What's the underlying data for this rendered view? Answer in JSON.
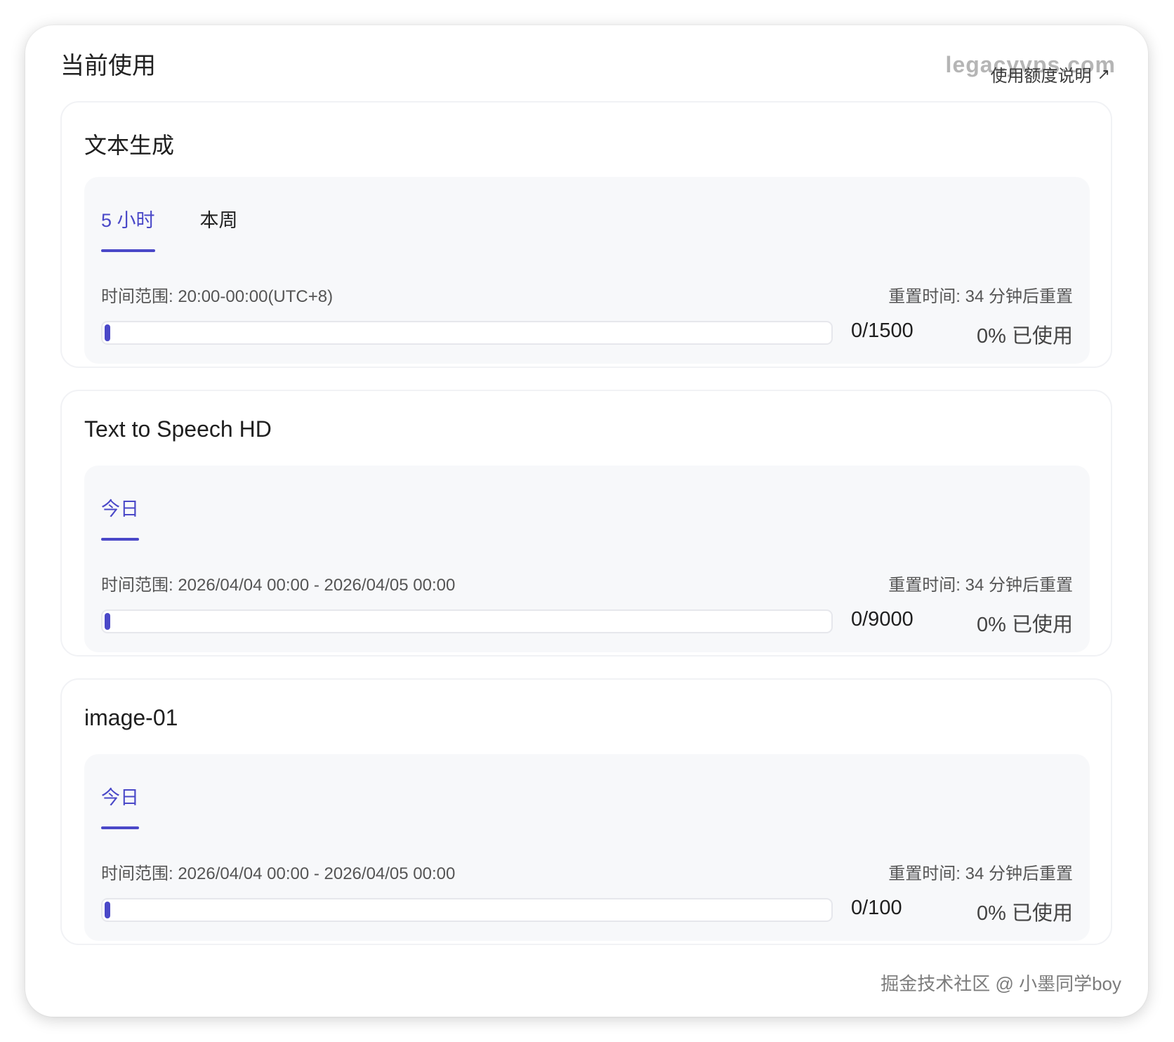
{
  "header": {
    "title": "当前使用",
    "watermark": "legacyvps.com",
    "quota_link": "使用额度说明",
    "quota_link_icon": "external-arrow-icon"
  },
  "accent_color": "#4a48c8",
  "cards": [
    {
      "title": "文本生成",
      "tabs": [
        {
          "label": "5 小时",
          "active": true
        },
        {
          "label": "本周",
          "active": false
        }
      ],
      "range": "时间范围: 20:00-00:00(UTC+8)",
      "reset": "重置时间: 34 分钟后重置",
      "usage": "0/1500",
      "percent": "0% 已使用",
      "progress": 0
    },
    {
      "title": "Text to Speech HD",
      "tabs": [
        {
          "label": "今日",
          "active": true
        }
      ],
      "range": "时间范围: 2026/04/04 00:00 - 2026/04/05 00:00",
      "reset": "重置时间: 34 分钟后重置",
      "usage": "0/9000",
      "percent": "0% 已使用",
      "progress": 0
    },
    {
      "title": "image-01",
      "tabs": [
        {
          "label": "今日",
          "active": true
        }
      ],
      "range": "时间范围: 2026/04/04 00:00 - 2026/04/05 00:00",
      "reset": "重置时间: 34 分钟后重置",
      "usage": "0/100",
      "percent": "0% 已使用",
      "progress": 0
    }
  ],
  "footer_watermark": "掘金技术社区 @ 小墨同学boy"
}
